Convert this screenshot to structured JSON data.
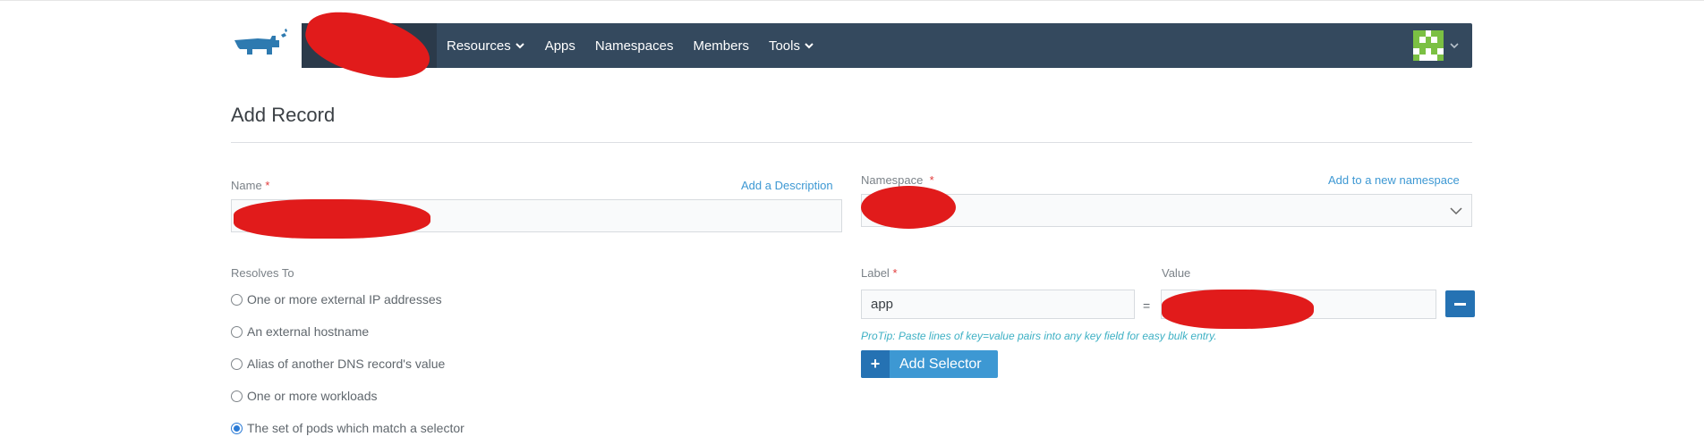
{
  "header": {
    "nav": [
      {
        "label": "Resources",
        "has_dropdown": true
      },
      {
        "label": "Apps",
        "has_dropdown": false
      },
      {
        "label": "Namespaces",
        "has_dropdown": false
      },
      {
        "label": "Members",
        "has_dropdown": false
      },
      {
        "label": "Tools",
        "has_dropdown": true
      }
    ],
    "colors": {
      "navbar": "#34495e",
      "accent": "#3d98d3",
      "logo": "#2e7ab0",
      "avatar": "#7bc043"
    }
  },
  "page": {
    "title": "Add Record"
  },
  "form": {
    "name": {
      "label": "Name",
      "required_mark": "*",
      "value": ""
    },
    "add_description": "Add a Description",
    "namespace": {
      "label": "Namespace",
      "required_mark": "*",
      "value": ""
    },
    "add_namespace": "Add to a new namespace",
    "resolves_to": {
      "label": "Resolves To",
      "options": [
        {
          "label": "One or more external IP addresses",
          "checked": false
        },
        {
          "label": "An external hostname",
          "checked": false
        },
        {
          "label": "Alias of another DNS record's value",
          "checked": false
        },
        {
          "label": "One or more workloads",
          "checked": false
        },
        {
          "label": "The set of pods which match a selector",
          "checked": true
        }
      ]
    },
    "selector": {
      "label_header": "Label",
      "label_required": "*",
      "value_header": "Value",
      "equals": "=",
      "rows": [
        {
          "label": "app",
          "value": ""
        }
      ],
      "protip": "ProTip: Paste lines of key=value pairs into any key field for easy bulk entry.",
      "add_button": "Add Selector",
      "add_button_icon": "+"
    }
  }
}
